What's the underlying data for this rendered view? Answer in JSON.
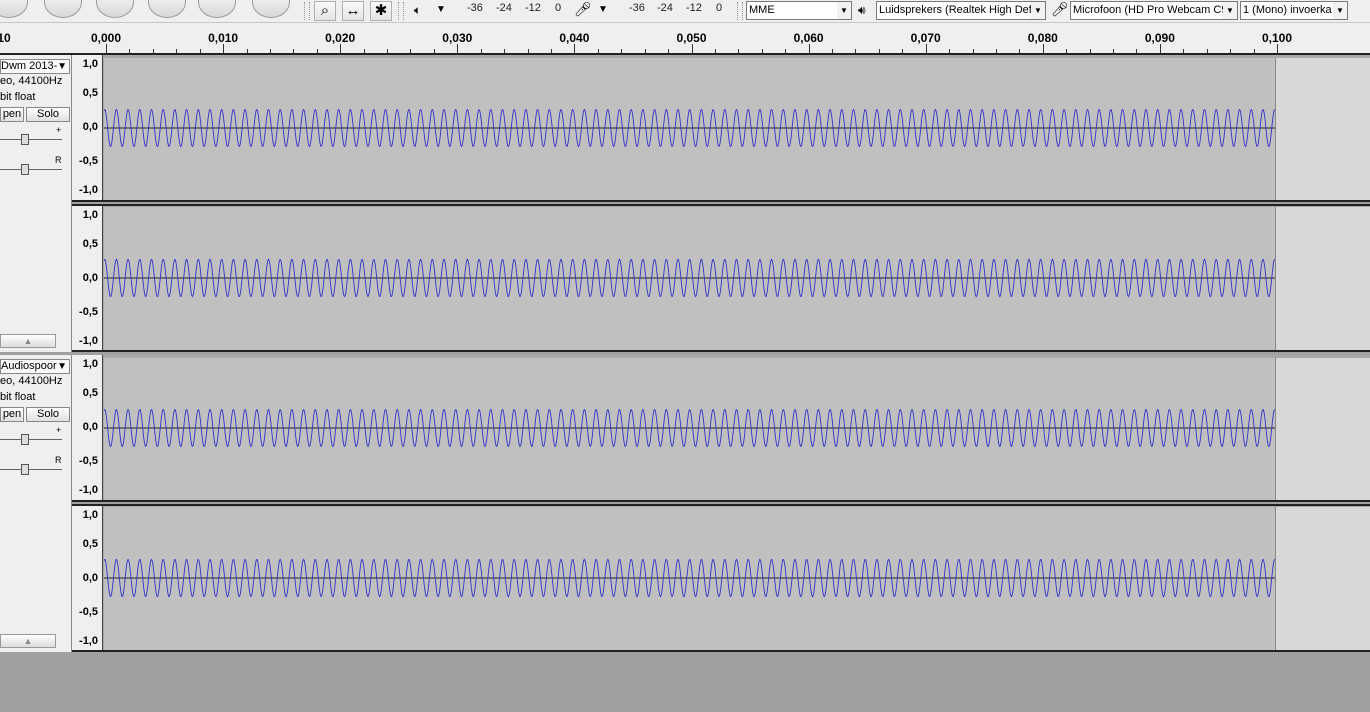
{
  "toolbar": {
    "meter_play": [
      "-36",
      "-24",
      "-12",
      "0"
    ],
    "meter_rec": [
      "-36",
      "-24",
      "-12",
      "0"
    ],
    "host": "MME",
    "playback_device": "Luidsprekers (Realtek High Def",
    "record_device": "Microfoon (HD Pro Webcam C9",
    "channels": "1 (Mono) invoerka"
  },
  "ruler": {
    "left_label": "10",
    "ticks": [
      "0,000",
      "0,010",
      "0,020",
      "0,030",
      "0,040",
      "0,050",
      "0,060",
      "0,070",
      "0,080",
      "0,090",
      "0,100"
    ]
  },
  "tracks": [
    {
      "name": "Dwm 2013-",
      "info1": "eo, 44100Hz",
      "info2": "bit float",
      "mute_label": "pen",
      "solo_label": "Solo",
      "gain_mark": "+",
      "pan_mark": "R"
    },
    {
      "name": "Audiospoor",
      "info1": "eo, 44100Hz",
      "info2": "bit float",
      "mute_label": "pen",
      "solo_label": "Solo",
      "gain_mark": "+",
      "pan_mark": "R"
    }
  ],
  "vscale": [
    "1,0",
    "0,5",
    "0,0",
    "-0,5",
    "-1,0"
  ],
  "colors": {
    "wave": "#3232c8",
    "wave_bg": "#c0c0c0",
    "ruler_bg": "#efefef"
  }
}
